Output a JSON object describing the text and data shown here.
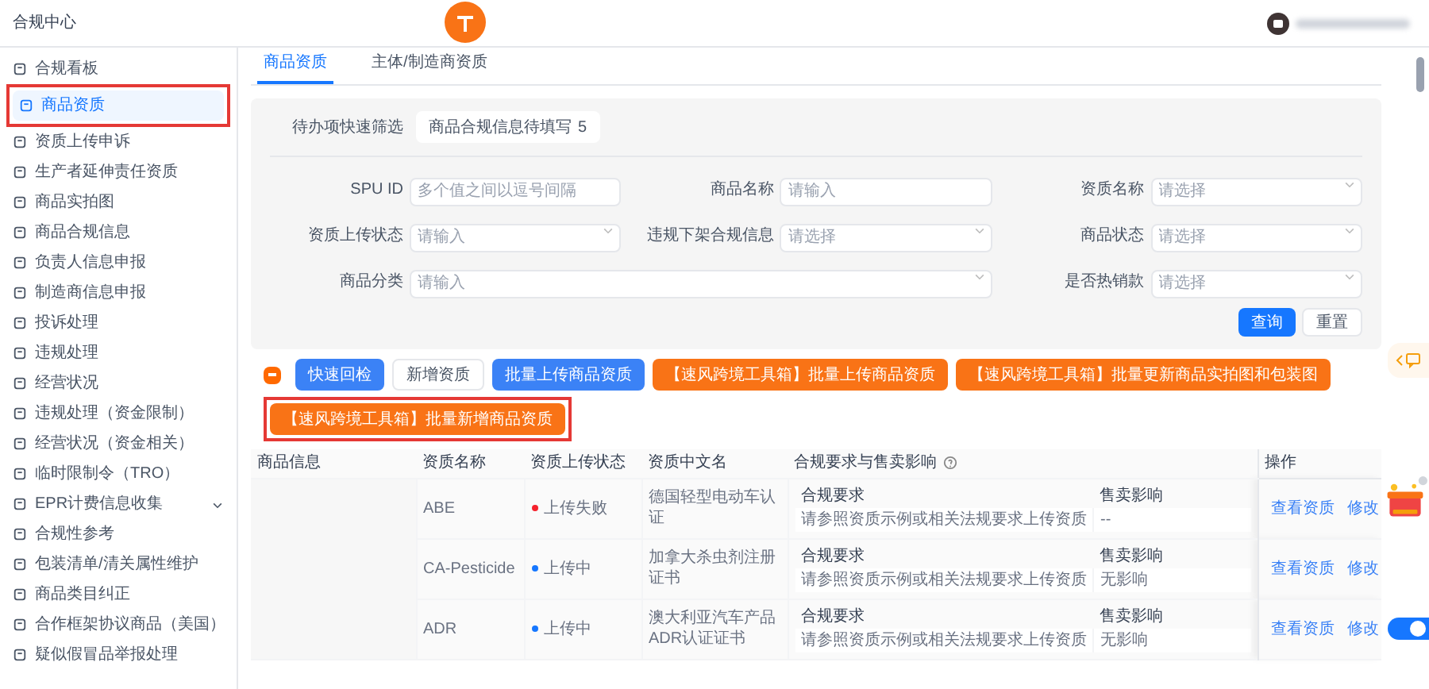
{
  "header": {
    "title": "合规中心"
  },
  "side_toggle": {
    "on": true
  },
  "sidebar": {
    "items": [
      {
        "label": "合规看板",
        "selected": false,
        "highlighted": false
      },
      {
        "label": "商品资质",
        "selected": true,
        "highlighted": true
      },
      {
        "label": "资质上传申诉",
        "selected": false,
        "highlighted": false
      },
      {
        "label": "生产者延伸责任资质",
        "selected": false,
        "highlighted": false
      },
      {
        "label": "商品实拍图",
        "selected": false,
        "highlighted": false
      },
      {
        "label": "商品合规信息",
        "selected": false,
        "highlighted": false
      },
      {
        "label": "负责人信息申报",
        "selected": false,
        "highlighted": false
      },
      {
        "label": "制造商信息申报",
        "selected": false,
        "highlighted": false
      },
      {
        "label": "投诉处理",
        "selected": false,
        "highlighted": false
      },
      {
        "label": "违规处理",
        "selected": false,
        "highlighted": false
      },
      {
        "label": "经营状况",
        "selected": false,
        "highlighted": false
      },
      {
        "label": "违规处理（资金限制）",
        "selected": false,
        "highlighted": false
      },
      {
        "label": "经营状况（资金相关）",
        "selected": false,
        "highlighted": false
      },
      {
        "label": "临时限制令（TRO）",
        "selected": false,
        "highlighted": false
      },
      {
        "label": "EPR计费信息收集",
        "selected": false,
        "highlighted": false,
        "expanded": false
      },
      {
        "label": "合规性参考",
        "selected": false,
        "highlighted": false
      },
      {
        "label": "包装清单/清关属性维护",
        "selected": false,
        "highlighted": false
      },
      {
        "label": "商品类目纠正",
        "selected": false,
        "highlighted": false
      },
      {
        "label": "合作框架协议商品（美国）",
        "selected": false,
        "highlighted": false
      },
      {
        "label": "疑似假冒品举报处理",
        "selected": false,
        "highlighted": false
      }
    ]
  },
  "tabs": [
    {
      "label": "商品资质",
      "selected": true
    },
    {
      "label": "主体/制造商资质",
      "selected": false
    }
  ],
  "filters": {
    "quick_filter": {
      "label": "待办项快速筛选",
      "chips": [
        {
          "label": "商品合规信息待填写",
          "count": "5"
        }
      ]
    },
    "fields": [
      {
        "label": "SPU ID",
        "kind": "input",
        "placeholder": "多个值之间以逗号间隔"
      },
      {
        "label": "商品名称",
        "kind": "input",
        "placeholder": "请输入"
      },
      {
        "label": "资质名称",
        "kind": "select",
        "placeholder": "请选择"
      },
      {
        "label": "资质上传状态",
        "kind": "select",
        "placeholder": "请输入"
      },
      {
        "label": "违规下架合规信息",
        "kind": "select",
        "placeholder": "请选择"
      },
      {
        "label": "商品状态",
        "kind": "select",
        "placeholder": "请选择"
      },
      {
        "label": "商品分类",
        "kind": "select",
        "placeholder": "请输入",
        "wide": true
      },
      {
        "label": "是否热销款",
        "kind": "select",
        "placeholder": "请选择"
      }
    ],
    "buttons": [
      {
        "label": "查询",
        "kind": "primary"
      },
      {
        "label": "重置",
        "kind": "default"
      }
    ]
  },
  "toolbar": {
    "select_all": {
      "indeterminate": true
    },
    "buttons": [
      {
        "label": "快速回检",
        "kind": "primary",
        "highlighted": false
      },
      {
        "label": "新增资质",
        "kind": "default",
        "highlighted": false
      },
      {
        "label": "批量上传商品资质",
        "kind": "primary",
        "highlighted": false
      },
      {
        "label": "【速风跨境工具箱】批量上传商品资质",
        "kind": "tool",
        "highlighted": false
      },
      {
        "label": "【速风跨境工具箱】批量更新商品实拍图和包装图",
        "kind": "tool",
        "highlighted": false
      },
      {
        "label": "【速风跨境工具箱】批量新增商品资质",
        "kind": "tool",
        "highlighted": true
      }
    ]
  },
  "table": {
    "columns": [
      "商品信息",
      "资质名称",
      "资质上传状态",
      "资质中文名",
      "合规要求与售卖影响",
      "操作"
    ],
    "rows": [
      {
        "name": "ABE",
        "status": {
          "text": "上传失败",
          "color": "#f5222d"
        },
        "cn_name": "德国轻型电动车认证",
        "inner_columns": [
          "合规要求",
          "售卖影响"
        ],
        "requirement": "请参照资质示例或相关法规要求上传资质",
        "impact": "--",
        "actions": [
          "查看资质",
          "修改"
        ]
      },
      {
        "name": "CA-Pesticide",
        "status": {
          "text": "上传中",
          "color": "#1677ff"
        },
        "cn_name": "加拿大杀虫剂注册证书",
        "inner_columns": [
          "合规要求",
          "售卖影响"
        ],
        "requirement": "请参照资质示例或相关法规要求上传资质",
        "impact": "无影响",
        "actions": [
          "查看资质",
          "修改"
        ]
      },
      {
        "name": "ADR",
        "status": {
          "text": "上传中",
          "color": "#1677ff"
        },
        "cn_name": "澳大利亚汽车产品ADR认证证书",
        "inner_columns": [
          "合规要求",
          "售卖影响"
        ],
        "requirement": "请参照资质示例或相关法规要求上传资质",
        "impact": "无影响",
        "actions": [
          "查看资质",
          "修改"
        ]
      }
    ]
  }
}
